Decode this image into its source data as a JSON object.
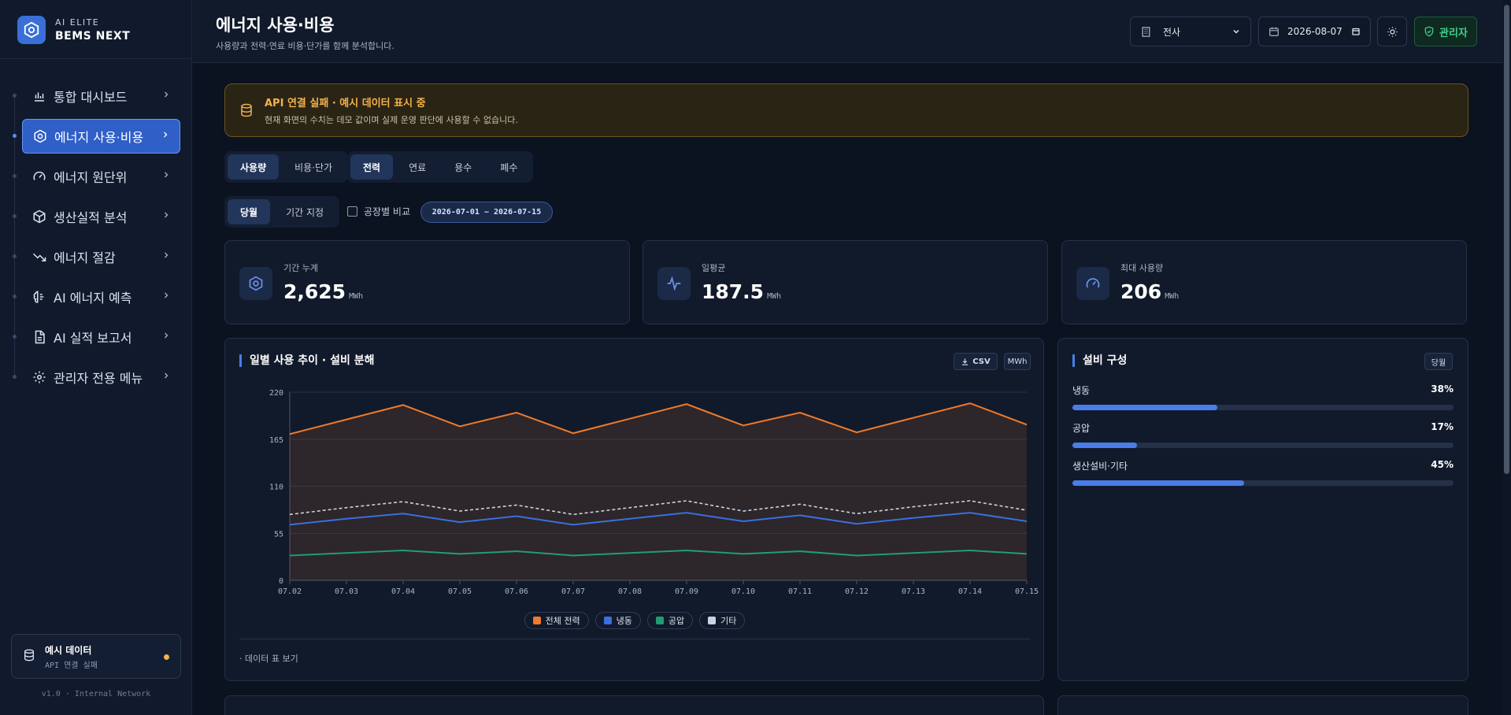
{
  "brand": {
    "top": "AI ELITE",
    "name": "BEMS NEXT"
  },
  "nav": [
    {
      "label": "통합 대시보드",
      "icon": "bar-chart-icon",
      "active": false
    },
    {
      "label": "에너지 사용·비용",
      "icon": "hexagon-icon",
      "active": true
    },
    {
      "label": "에너지 원단위",
      "icon": "gauge-icon",
      "active": false
    },
    {
      "label": "생산실적 분석",
      "icon": "box-icon",
      "active": false
    },
    {
      "label": "에너지 절감",
      "icon": "trend-down-icon",
      "active": false
    },
    {
      "label": "AI 에너지 예측",
      "icon": "brain-icon",
      "active": false
    },
    {
      "label": "AI 실적 보고서",
      "icon": "document-icon",
      "active": false
    },
    {
      "label": "관리자 전용 메뉴",
      "icon": "gear-icon",
      "active": false
    }
  ],
  "demo": {
    "title": "예시 데이터",
    "subtitle": "API 연결 실패"
  },
  "version": "v1.0 · Internal Network",
  "header": {
    "title": "에너지 사용·비용",
    "subtitle": "사용량과 전력·연료 비용·단가를 함께 분석합니다.",
    "site_select": "전사",
    "date": "2026-08-07",
    "admin_label": "관리자"
  },
  "alert": {
    "title": "API 연결 실패 · 예시 데이터 표시 중",
    "desc": "현재 화면의 수치는 데모 값이며 실제 운영 판단에 사용할 수 없습니다."
  },
  "tabs_view": [
    "사용량",
    "비용·단가"
  ],
  "tabs_energy": [
    "전력",
    "연료",
    "용수",
    "폐수"
  ],
  "tabs_period": [
    "당월",
    "기간 지정"
  ],
  "compare_label": "공장별 비교",
  "date_range": "2026-07-01 ~ 2026-07-15",
  "kpis": [
    {
      "label": "기간 누계",
      "value": "2,625",
      "unit": "MWh",
      "icon": "hexagon-icon"
    },
    {
      "label": "일평균",
      "value": "187.5",
      "unit": "MWh",
      "icon": "activity-icon"
    },
    {
      "label": "최대 사용량",
      "value": "206",
      "unit": "MWh",
      "icon": "gauge-icon"
    }
  ],
  "trend_panel": {
    "title": "일별 사용 추이 · 설비 분해",
    "csv_label": "CSV",
    "unit_label": "MWh",
    "table_toggle": "· 데이터 표 보기"
  },
  "composition_panel": {
    "title": "설비 구성",
    "badge": "당월",
    "items": [
      {
        "label": "냉동",
        "pct_label": "38%",
        "pct": 38
      },
      {
        "label": "공압",
        "pct_label": "17%",
        "pct": 17
      },
      {
        "label": "생산설비·기타",
        "pct_label": "45%",
        "pct": 45
      }
    ]
  },
  "colors": {
    "accent": "#4a7de8",
    "total": "#f07a2a",
    "freezing": "#3a6fe0",
    "air": "#1f9e72",
    "other": "#c9d2e3",
    "warning": "#f3b24a",
    "admin": "#3fd08a"
  },
  "chart_data": {
    "type": "line",
    "x": [
      "07.02",
      "07.03",
      "07.04",
      "07.05",
      "07.06",
      "07.07",
      "07.08",
      "07.09",
      "07.10",
      "07.11",
      "07.12",
      "07.13",
      "07.14",
      "07.15"
    ],
    "ylim": [
      0,
      220
    ],
    "yticks": [
      0,
      55,
      110,
      165,
      220
    ],
    "series": [
      {
        "name": "전체 전력",
        "color": "#f07a2a",
        "values": [
          171,
          188,
          205,
          180,
          196,
          172,
          189,
          206,
          181,
          196,
          173,
          190,
          207,
          182
        ]
      },
      {
        "name": "냉동",
        "color": "#3a6fe0",
        "values": [
          65,
          72,
          78,
          68,
          75,
          65,
          72,
          79,
          69,
          76,
          66,
          73,
          79,
          69
        ]
      },
      {
        "name": "공압",
        "color": "#1f9e72",
        "values": [
          29,
          32,
          35,
          31,
          34,
          29,
          32,
          35,
          31,
          34,
          29,
          32,
          35,
          31
        ]
      },
      {
        "name": "기타",
        "color": "#c9d2e3",
        "values": [
          77,
          85,
          92,
          81,
          88,
          77,
          85,
          93,
          81,
          89,
          78,
          86,
          93,
          82
        ]
      }
    ],
    "grid": true,
    "legend": "bottom"
  }
}
